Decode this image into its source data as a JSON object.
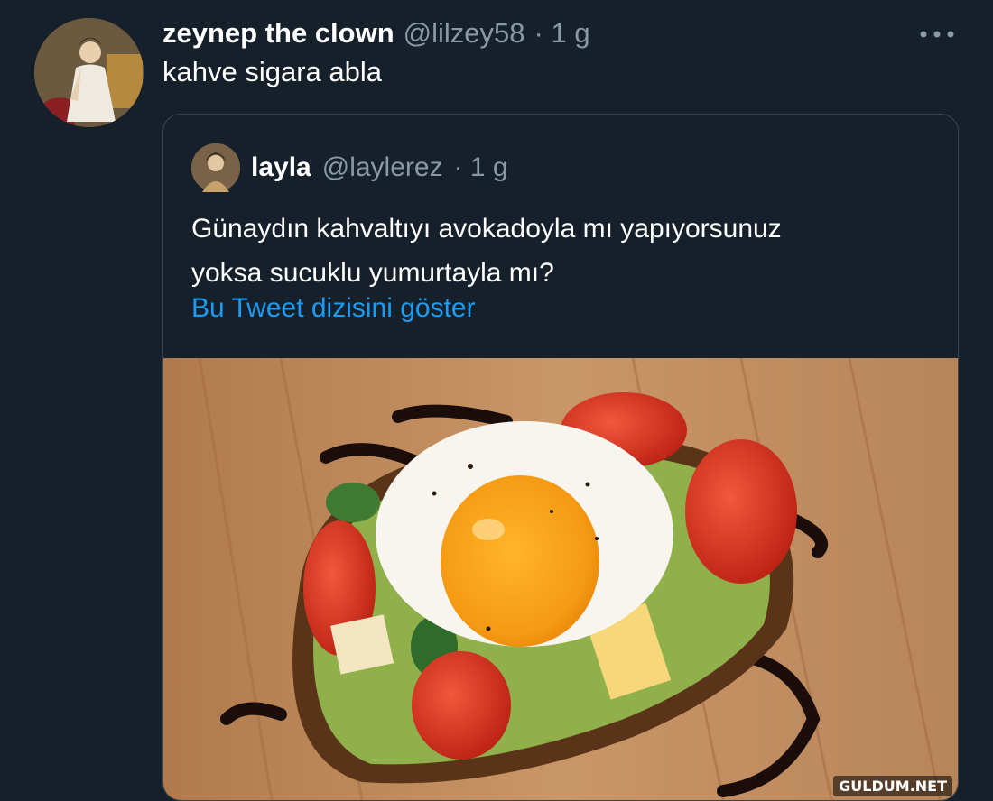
{
  "tweet": {
    "display_name": "zeynep the clown",
    "handle": "@lilzey58",
    "time": "· 1 g",
    "text": "kahve sigara abla",
    "more_icon": "more-dots-icon"
  },
  "quoted_tweet": {
    "display_name": "layla",
    "handle": "@laylerez",
    "time": "· 1 g",
    "text_line1": "Günaydın kahvaltıyı avokadoyla mı yapıyorsunuz",
    "text_line2": "yoksa sucuklu yumurtayla mı?",
    "show_thread": "Bu Tweet dizisini göster"
  },
  "watermark": "GULDUM.NET",
  "colors": {
    "background": "#15202b",
    "secondary_text": "#8b98a5",
    "link": "#1d9bf0",
    "border": "#38444d"
  }
}
